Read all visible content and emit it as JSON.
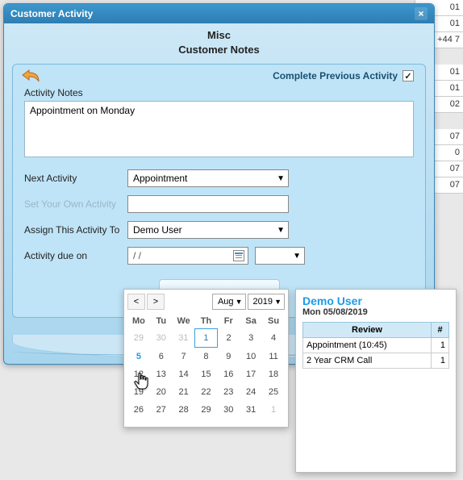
{
  "bg_rows": [
    "01",
    "01",
    "+44 7",
    "",
    "01",
    "01",
    "02",
    "",
    "07",
    "0",
    "07",
    "07",
    "",
    "",
    "",
    ""
  ],
  "dialog": {
    "title": "Customer Activity",
    "heading_line1": "Misc",
    "heading_line2": "Customer Notes"
  },
  "panel": {
    "complete_prev_label": "Complete Previous Activity",
    "complete_prev_checked": "✓",
    "notes_label": "Activity Notes",
    "notes_value": "Appointment on Monday",
    "next_activity_label": "Next Activity",
    "next_activity_value": "Appointment",
    "own_activity_label": "Set Your Own Activity",
    "own_activity_value": "",
    "assign_label": "Assign This Activity To",
    "assign_value": "Demo User",
    "due_label": "Activity due on",
    "due_value": "/          /",
    "time_value": ""
  },
  "calendar": {
    "month": "Aug",
    "year": "2019",
    "dow": [
      "Mo",
      "Tu",
      "We",
      "Th",
      "Fr",
      "Sa",
      "Su"
    ],
    "weeks": [
      [
        {
          "d": "29",
          "dim": true
        },
        {
          "d": "30",
          "dim": true
        },
        {
          "d": "31",
          "dim": true
        },
        {
          "d": "1",
          "today": true
        },
        {
          "d": "2"
        },
        {
          "d": "3"
        },
        {
          "d": "4"
        }
      ],
      [
        {
          "d": "5",
          "sel": true
        },
        {
          "d": "6"
        },
        {
          "d": "7"
        },
        {
          "d": "8"
        },
        {
          "d": "9"
        },
        {
          "d": "10"
        },
        {
          "d": "11"
        }
      ],
      [
        {
          "d": "12"
        },
        {
          "d": "13"
        },
        {
          "d": "14"
        },
        {
          "d": "15"
        },
        {
          "d": "16"
        },
        {
          "d": "17"
        },
        {
          "d": "18"
        }
      ],
      [
        {
          "d": "19"
        },
        {
          "d": "20"
        },
        {
          "d": "21"
        },
        {
          "d": "22"
        },
        {
          "d": "23"
        },
        {
          "d": "24"
        },
        {
          "d": "25"
        }
      ],
      [
        {
          "d": "26"
        },
        {
          "d": "27"
        },
        {
          "d": "28"
        },
        {
          "d": "29"
        },
        {
          "d": "30"
        },
        {
          "d": "31"
        },
        {
          "d": "1",
          "dim": true
        }
      ]
    ],
    "prev": "<",
    "next": ">"
  },
  "sidepop": {
    "name": "Demo User",
    "date": "Mon 05/08/2019",
    "col_review": "Review",
    "col_count": "#",
    "rows": [
      {
        "label": "Appointment (10:45)",
        "count": "1"
      },
      {
        "label": "2 Year CRM Call",
        "count": "1"
      }
    ]
  }
}
